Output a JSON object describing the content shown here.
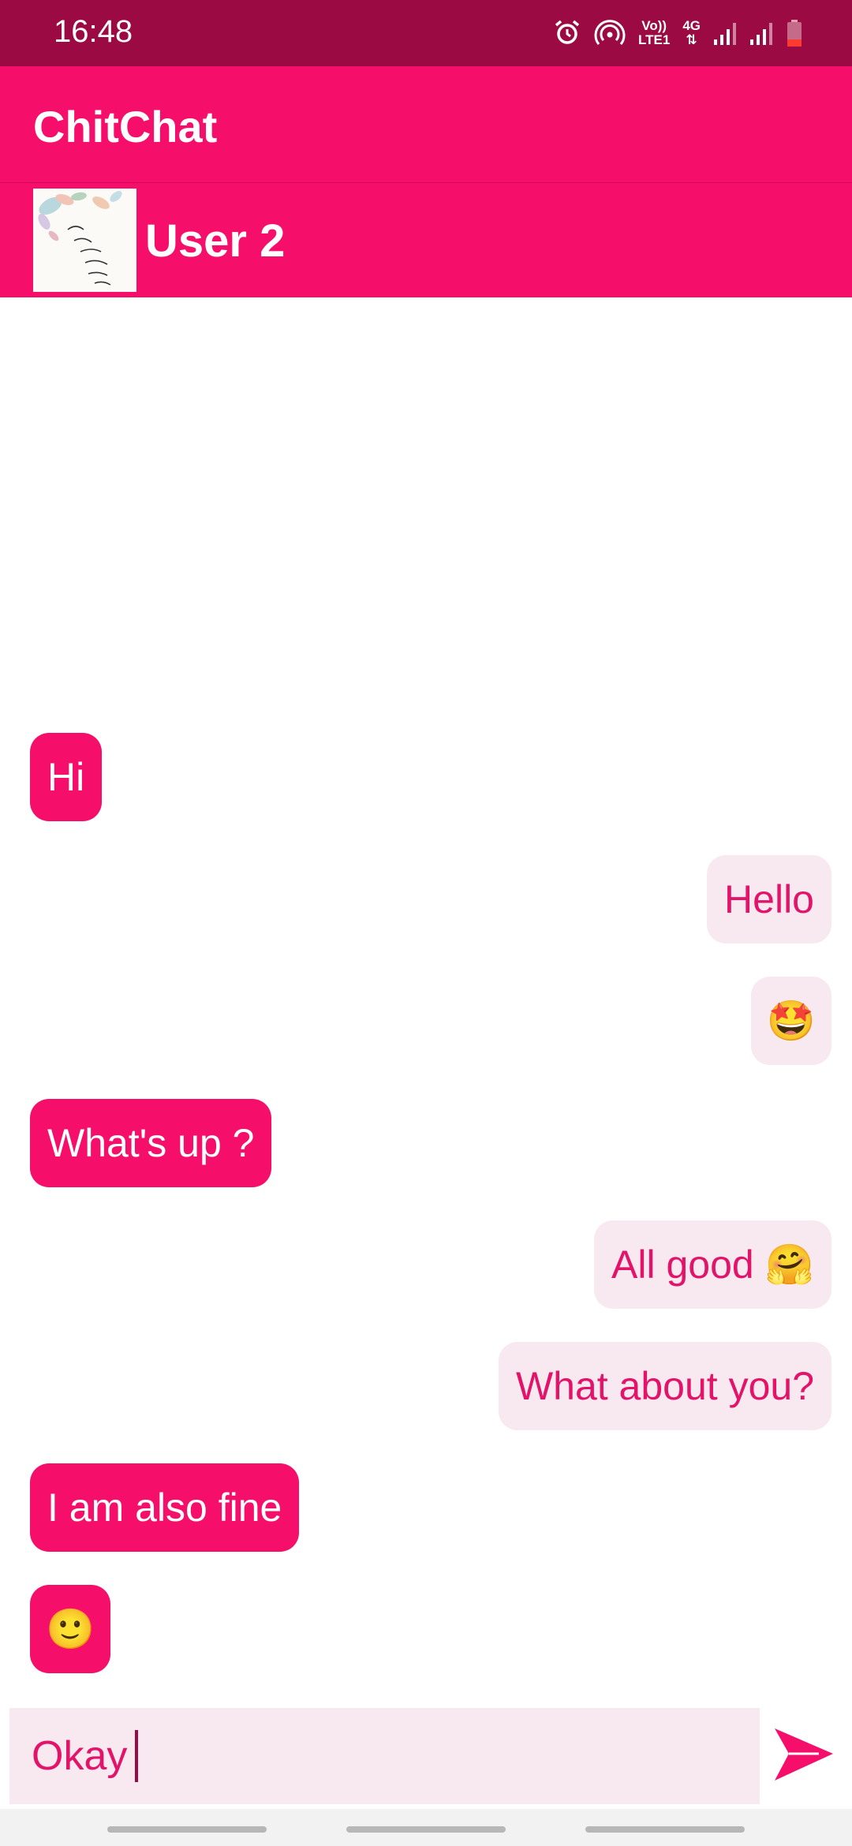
{
  "status_bar": {
    "time": "16:48",
    "icons": [
      "alarm-icon",
      "hotspot-icon",
      "volte-icon",
      "network-4g-icon",
      "signal-icon",
      "signal-icon",
      "battery-low-icon"
    ],
    "volte_line1": "Vo))",
    "volte_line2": "LTE1",
    "network_type": "4G"
  },
  "app_bar": {
    "title": "ChitChat"
  },
  "chat_header": {
    "contact_name": "User 2",
    "avatar_icon": "profile-picture-floral-quote"
  },
  "messages": [
    {
      "direction": "received",
      "text": "Hi"
    },
    {
      "direction": "sent",
      "text": "Hello"
    },
    {
      "direction": "sent",
      "text": "",
      "emoji": "🤩"
    },
    {
      "direction": "received",
      "text": "What's up ?"
    },
    {
      "direction": "sent",
      "text": "All good",
      "emoji": "🤗"
    },
    {
      "direction": "sent",
      "text": "What about you?"
    },
    {
      "direction": "received",
      "text": "I am also fine"
    },
    {
      "direction": "received",
      "text": "",
      "emoji": "🙂"
    }
  ],
  "composer": {
    "input_value": "Okay",
    "send_icon": "send-icon"
  },
  "colors": {
    "status_bar": "#9c0a43",
    "primary": "#f50f6a",
    "sent_bubble": "#f7e9ef",
    "sent_text": "#e3136a",
    "received_text": "#ffffff"
  }
}
